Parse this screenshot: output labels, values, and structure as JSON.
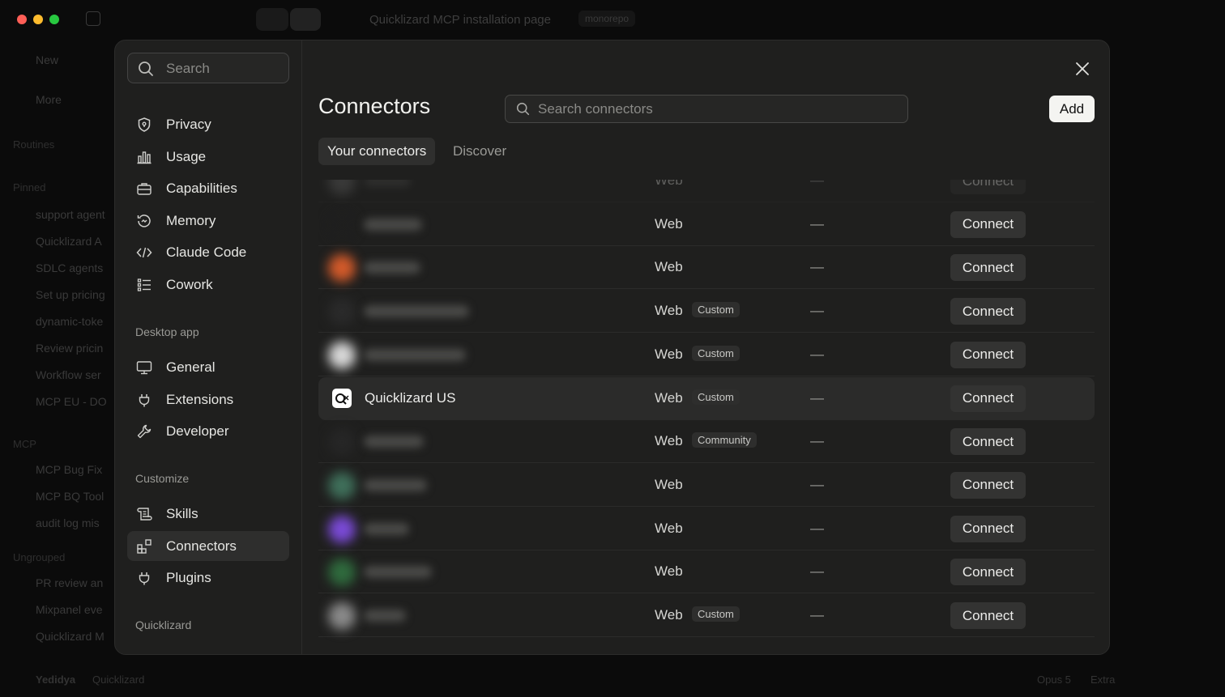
{
  "window": {
    "title": "Quicklizard MCP installation page",
    "branch": "monorepo"
  },
  "background": {
    "sidebar_items": [
      {
        "label": "New"
      },
      {
        "label": "More"
      },
      {
        "label": "Routines"
      },
      {
        "label": "Pinned"
      },
      {
        "label": "support agent"
      },
      {
        "label": "Quicklizard A"
      },
      {
        "label": "SDLC agents"
      },
      {
        "label": "Set up pricing"
      },
      {
        "label": "dynamic-toke"
      },
      {
        "label": "Review pricin"
      },
      {
        "label": "Workflow ser"
      },
      {
        "label": "MCP EU - DO"
      },
      {
        "label": "MCP"
      },
      {
        "label": "MCP Bug Fix"
      },
      {
        "label": "MCP BQ Tool"
      },
      {
        "label": "audit log mis"
      },
      {
        "label": "Ungrouped"
      },
      {
        "label": "PR review an"
      },
      {
        "label": "Mixpanel eve"
      },
      {
        "label": "Quicklizard M"
      }
    ],
    "user_name": "Yedidya",
    "user_org": "Quicklizard",
    "model_label": "Opus 5",
    "extra_label": "Extra"
  },
  "settings_sidebar": {
    "search_placeholder": "Search",
    "items_top": [
      {
        "label": "Privacy",
        "icon": "shield-icon"
      },
      {
        "label": "Usage",
        "icon": "bar-chart-icon"
      },
      {
        "label": "Capabilities",
        "icon": "toolbox-icon"
      },
      {
        "label": "Memory",
        "icon": "memory-icon"
      },
      {
        "label": "Claude Code",
        "icon": "code-icon"
      },
      {
        "label": "Cowork",
        "icon": "list-icon"
      }
    ],
    "section_desktop": "Desktop app",
    "items_desktop": [
      {
        "label": "General",
        "icon": "monitor-icon"
      },
      {
        "label": "Extensions",
        "icon": "plug-icon"
      },
      {
        "label": "Developer",
        "icon": "wrench-icon"
      }
    ],
    "section_customize": "Customize",
    "items_customize": [
      {
        "label": "Skills",
        "icon": "scroll-icon"
      },
      {
        "label": "Connectors",
        "icon": "connectors-icon",
        "active": true
      },
      {
        "label": "Plugins",
        "icon": "plug-icon"
      }
    ],
    "section_org": "Quicklizard"
  },
  "main": {
    "title": "Connectors",
    "search_placeholder": "Search connectors",
    "add_label": "Add",
    "tabs": [
      {
        "label": "Your connectors",
        "active": true
      },
      {
        "label": "Discover",
        "active": false
      }
    ],
    "rows": [
      {
        "name": "",
        "type": "Web",
        "badge": "",
        "status": "—",
        "action": "Connect",
        "logo_color": "#6a6a6a"
      },
      {
        "name": "",
        "type": "Web",
        "badge": "",
        "status": "—",
        "action": "Connect",
        "logo_color": "#1f1f1e"
      },
      {
        "name": "",
        "type": "Web",
        "badge": "",
        "status": "—",
        "action": "Connect",
        "logo_color": "#d25a2a"
      },
      {
        "name": "",
        "type": "Web",
        "badge": "Custom",
        "status": "—",
        "action": "Connect",
        "logo_color": "#2a2a2a"
      },
      {
        "name": "",
        "type": "Web",
        "badge": "Custom",
        "status": "—",
        "action": "Connect",
        "logo_color": "#d8d8d8"
      },
      {
        "name": "Quicklizard US",
        "type": "Web",
        "badge": "Custom",
        "status": "—",
        "action": "Connect",
        "logo_color": "#ffffff",
        "highlight": true
      },
      {
        "name": "",
        "type": "Web",
        "badge": "Community",
        "status": "—",
        "action": "Connect",
        "logo_color": "#262626"
      },
      {
        "name": "",
        "type": "Web",
        "badge": "",
        "status": "—",
        "action": "Connect",
        "logo_color": "#3f6f5a"
      },
      {
        "name": "",
        "type": "Web",
        "badge": "",
        "status": "—",
        "action": "Connect",
        "logo_color": "#7a4ad6"
      },
      {
        "name": "",
        "type": "Web",
        "badge": "",
        "status": "—",
        "action": "Connect",
        "logo_color": "#2f6a3d"
      },
      {
        "name": "",
        "type": "Web",
        "badge": "Custom",
        "status": "—",
        "action": "Connect",
        "logo_color": "#8a8a8a"
      }
    ]
  }
}
